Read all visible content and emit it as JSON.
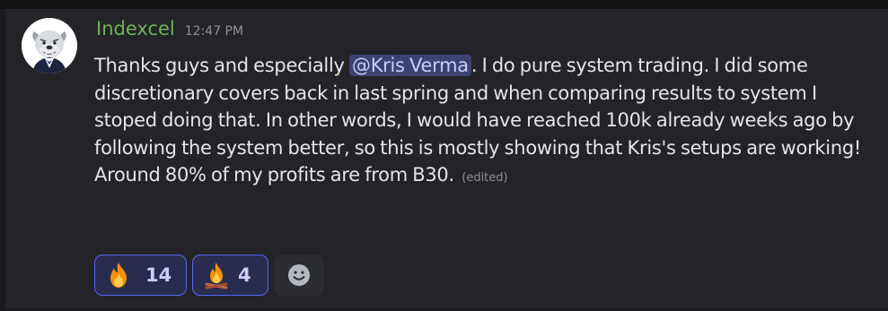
{
  "message": {
    "author": "Indexcel",
    "timestamp": "12:47 PM",
    "text_before_mention": "Thanks guys and especially ",
    "mention": "@Kris Verma",
    "text_after_mention": ". I do pure system trading. I did some discretionary covers back in last spring and when comparing results to system I stoped doing that. In other words, I would have reached 100k already weeks ago by following the system better, so this is mostly showing that Kris's setups are working! Around 80% of my profits are from B30.",
    "edited_label": "(edited)"
  },
  "reactions": [
    {
      "emoji": "fire-icon",
      "count": "14"
    },
    {
      "emoji": "campfire-icon",
      "count": "4"
    }
  ],
  "add_reaction_icon": "smiley-add-reaction-icon",
  "colors": {
    "username": "#6fb159",
    "mention_bg": "#3d4272",
    "reaction_border": "#5865f2",
    "message_bg": "#232328"
  }
}
